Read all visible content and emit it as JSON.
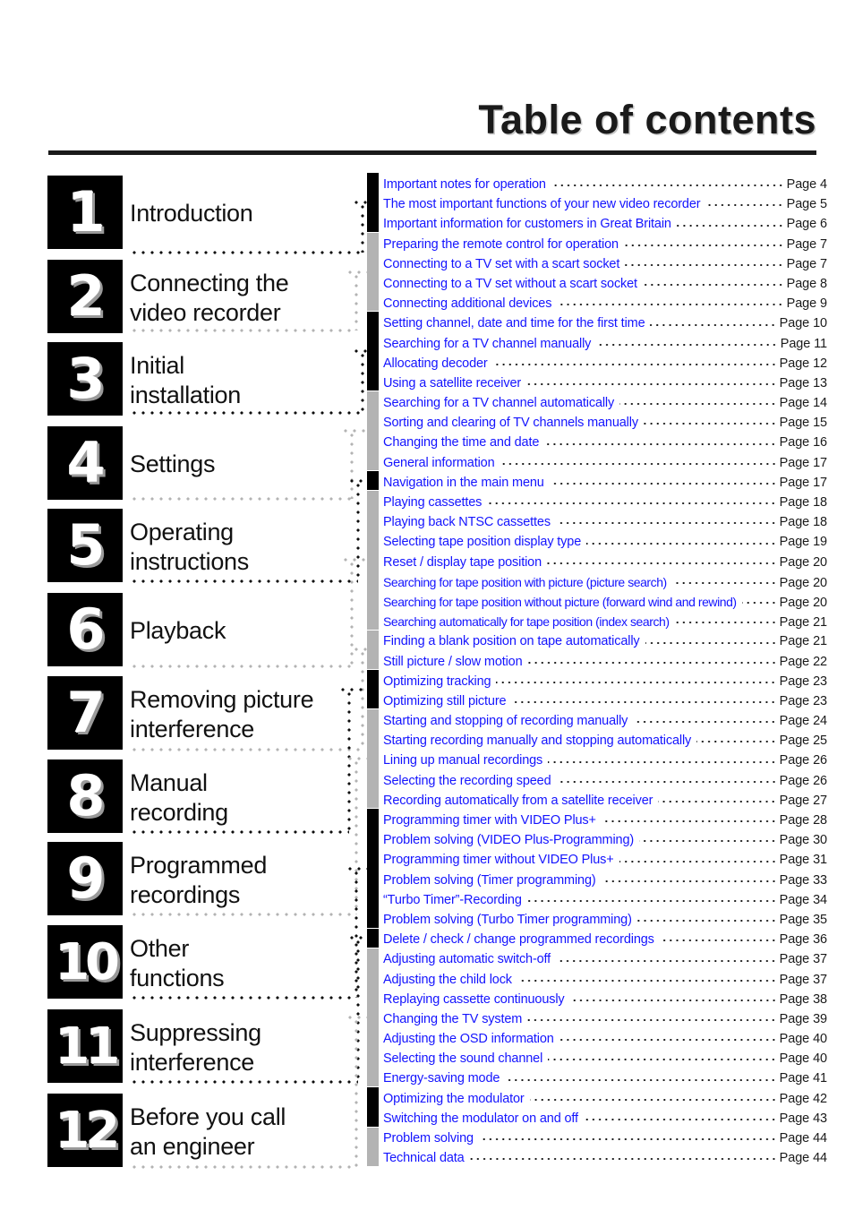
{
  "page": {
    "title": "Table of contents",
    "accent_blue": "#1414ff",
    "ink": "#1a1a1a",
    "bar_dark": "#000000",
    "bar_light": "#b3b3b3"
  },
  "chapters": [
    {
      "number": "1",
      "title": "Introduction"
    },
    {
      "number": "2",
      "title": "Connecting the\nvideo recorder"
    },
    {
      "number": "3",
      "title": "Initial\ninstallation"
    },
    {
      "number": "4",
      "title": "Settings"
    },
    {
      "number": "5",
      "title": "Operating\ninstructions"
    },
    {
      "number": "6",
      "title": "Playback"
    },
    {
      "number": "7",
      "title": "Removing picture\ninterference"
    },
    {
      "number": "8",
      "title": "Manual\nrecording"
    },
    {
      "number": "9",
      "title": "Programmed\nrecordings"
    },
    {
      "number": "10",
      "title": "Other\nfunctions"
    },
    {
      "number": "11",
      "title": "Suppressing\ninterference"
    },
    {
      "number": "12",
      "title": "Before you call\nan engineer"
    }
  ],
  "toc": [
    {
      "label": "Important notes for operation",
      "page": "Page 4"
    },
    {
      "label": "The most important functions of your new video recorder",
      "page": "Page 5"
    },
    {
      "label": "Important information for customers in Great Britain",
      "page": "Page 6"
    },
    {
      "label": "Preparing the remote control for operation",
      "page": "Page 7"
    },
    {
      "label": "Connecting to a TV set with a scart socket",
      "page": "Page 7"
    },
    {
      "label": "Connecting to a TV set without a scart socket",
      "page": "Page 8"
    },
    {
      "label": "Connecting additional devices",
      "page": "Page 9"
    },
    {
      "label": "Setting channel, date and time for the  first time",
      "page": "Page 10"
    },
    {
      "label": "Searching for a TV channel manually",
      "page": "Page 11"
    },
    {
      "label": "Allocating decoder",
      "page": "Page 12"
    },
    {
      "label": "Using a satellite receiver",
      "page": "Page 13"
    },
    {
      "label": "Searching for a TV channel automatically",
      "page": "Page 14"
    },
    {
      "label": "Sorting and clearing of TV channels manually",
      "page": "Page 15"
    },
    {
      "label": "Changing the time and  date",
      "page": "Page 16"
    },
    {
      "label": "General information",
      "page": "Page 17"
    },
    {
      "label": "Navigation in the main menu",
      "page": "Page 17"
    },
    {
      "label": "Playing cassettes",
      "page": "Page 18"
    },
    {
      "label": "Playing back NTSC cassettes",
      "page": "Page 18"
    },
    {
      "label": "Selecting tape position display type",
      "page": "Page 19"
    },
    {
      "label": "Reset / display tape position",
      "page": "Page 20"
    },
    {
      "label": "Searching for tape position with picture (picture search)",
      "page": "Page 20"
    },
    {
      "label": "Searching for tape position without picture (forward wind and rewind)",
      "page": "Page 20"
    },
    {
      "label": "Searching automatically for tape position (index search)",
      "page": "Page 21"
    },
    {
      "label": "Finding a blank position on tape automatically",
      "page": "Page 21"
    },
    {
      "label": "Still picture /  slow motion",
      "page": "Page 22"
    },
    {
      "label": "Optimizing tracking",
      "page": "Page 23"
    },
    {
      "label": "Optimizing still picture",
      "page": "Page 23"
    },
    {
      "label": "Starting and stopping of recording manually",
      "page": "Page 24"
    },
    {
      "label": "Starting recording manually and stopping automatically",
      "page": "Page 25"
    },
    {
      "label": "Lining up manual recordings",
      "page": "Page 26"
    },
    {
      "label": "Selecting the recording speed",
      "page": "Page 26"
    },
    {
      "label": "Recording automatically from a satellite receiver",
      "page": "Page 27"
    },
    {
      "label": "Programming timer with VIDEO Plus+",
      "page": "Page 28"
    },
    {
      "label": "Problem solving (VIDEO Plus-Programming)",
      "page": "Page 30"
    },
    {
      "label": "Programming timer without VIDEO Plus+",
      "page": "Page 31"
    },
    {
      "label": "Problem solving (Timer programming)",
      "page": "Page 33"
    },
    {
      "label": "“Turbo Timer”-Recording",
      "page": "Page 34"
    },
    {
      "label": "Problem solving (Turbo Timer programming)",
      "page": "Page 35"
    },
    {
      "label": "Delete / check / change programmed recordings",
      "page": "Page 36"
    },
    {
      "label": "Adjusting automatic switch-off",
      "page": "Page 37"
    },
    {
      "label": "Adjusting the child lock",
      "page": "Page 37"
    },
    {
      "label": "Replaying cassette continuously",
      "page": "Page 38"
    },
    {
      "label": "Changing the TV system",
      "page": "Page 39"
    },
    {
      "label": "Adjusting the OSD information",
      "page": "Page 40"
    },
    {
      "label": "Selecting the sound channel",
      "page": "Page 40"
    },
    {
      "label": "Energy-saving mode",
      "page": "Page 41"
    },
    {
      "label": "Optimizing the modulator",
      "page": "Page 42"
    },
    {
      "label": "Switching the modulator on and off",
      "page": "Page 43"
    },
    {
      "label": "Problem solving",
      "page": "Page 44"
    },
    {
      "label": "Technical data",
      "page": "Page 44"
    }
  ]
}
